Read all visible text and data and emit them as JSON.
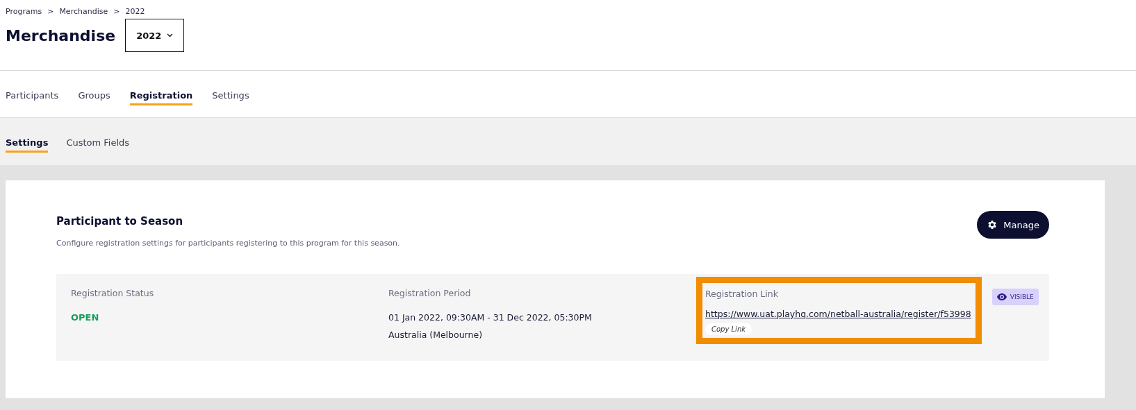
{
  "breadcrumb": [
    "Programs",
    "Merchandise",
    "2022"
  ],
  "breadcrumb_separator": ">",
  "title": "Merchandise",
  "season_dropdown": {
    "value": "2022"
  },
  "tabs": [
    {
      "label": "Participants",
      "selected": false
    },
    {
      "label": "Groups",
      "selected": false
    },
    {
      "label": "Registration",
      "selected": true
    },
    {
      "label": "Settings",
      "selected": false
    }
  ],
  "subtabs": [
    {
      "label": "Settings",
      "selected": true
    },
    {
      "label": "Custom Fields",
      "selected": false
    }
  ],
  "section": {
    "title": "Participant to Season",
    "description": "Configure registration settings for participants registering to this program for this season.",
    "manage_button": "Manage"
  },
  "registration": {
    "status_label": "Registration Status",
    "status": "OPEN",
    "period_label": "Registration Period",
    "period": "01 Jan 2022, 09:30AM - 31 Dec 2022, 05:30PM",
    "timezone": "Australia (Melbourne)",
    "link_label": "Registration Link",
    "link": "https://www.uat.playhq.com/netball-australia/register/f53998",
    "copy_button": "Copy Link",
    "link_highlighted": true,
    "visibility_badge": "VISIBLE"
  }
}
